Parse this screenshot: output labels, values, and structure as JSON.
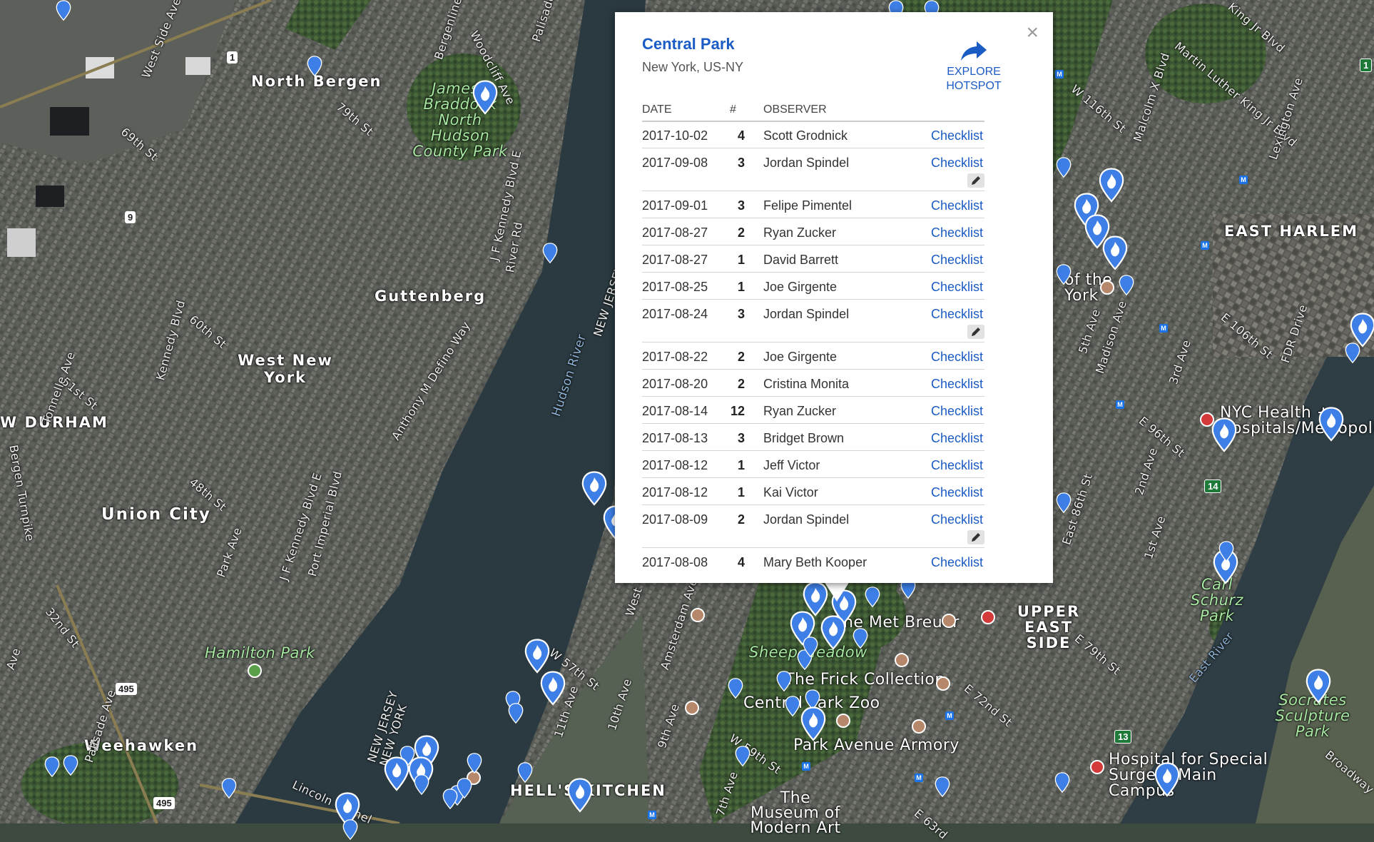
{
  "map": {
    "labels": {
      "north_bergen": "North Bergen",
      "guttenberg": "Guttenberg",
      "west_new_york": "West New York",
      "union_city": "Union City",
      "weehawken": "Weehawken",
      "hells_kitchen": "HELL'S KITCHEN",
      "upper_east_side": "UPPER EAST SIDE",
      "east_harlem": "EAST HARLEM",
      "w_durham": "W DURHAM",
      "james_braddock": "James J Braddock North Hudson County Park",
      "hamilton_park": "Hamilton Park",
      "carl_schurz": "Carl Schurz Park",
      "socrates": "Socrates Sculpture Park",
      "sheep_meadow": "Sheep Meadow",
      "met_breuer": "The Met Breuer",
      "frick": "The Frick Collection",
      "central_park_zoo": "Central Park Zoo",
      "park_ave_armory": "Park Avenue Armory",
      "moma": "The Museum of Modern Art",
      "nyc_health": "NYC Health + Hospitals/Metropolitan",
      "hss": "Hospital for Special Surgery Main Campus",
      "museum_city_ny": "of the York",
      "hudson_river": "Hudson River",
      "nj_ny_1": "NEW JERSEY NEW YORK",
      "nj_ny_2": "NEW JERSEY",
      "st_west_side_ave": "West Side Ave",
      "st_bergenline": "Bergenline Ave",
      "st_woodcliff": "Woodcliff Ave",
      "st_palisade": "Palisade Ave",
      "st_69th": "69th St",
      "st_79th": "79th St",
      "st_60th": "60th St",
      "st_51st": "51st St",
      "st_48th": "48th St",
      "st_32nd": "32nd St",
      "st_kennedy": "Kennedy Blvd",
      "st_jfk": "J F Kennedy Blvd E",
      "st_anthony": "Anthony M Defino Way",
      "st_river": "River Rd",
      "st_tonnelle": "Tonnelle Ave",
      "st_bergen_tpk": "Bergen Turnpike",
      "st_park_ave": "Park Ave",
      "st_port_imperial": "Port Imperial Blvd",
      "st_jfk_2": "J F Kennedy Blvd E",
      "st_lincoln": "Lincoln Tunnel",
      "st_w57": "W 57th St",
      "st_11th": "11th Ave",
      "st_10th": "10th Ave",
      "st_9th": "9th Ave",
      "st_7th": "7th Ave",
      "st_amsterdam": "Amsterdam Ave",
      "st_w59": "W 59th St",
      "st_e72": "E 72nd St",
      "st_e79": "E 79th St",
      "st_e86": "East 86th St",
      "st_e96": "E 96th St",
      "st_e106": "E 106th St",
      "st_w116": "W 116th St",
      "st_mlk": "Martin Luther King Jr Blvd",
      "st_malcolm": "Malcolm X Blvd",
      "st_5th": "5th Ave",
      "st_madison": "Madison Ave",
      "st_3rd": "3rd Ave",
      "st_2nd": "2nd Ave",
      "st_1st": "1st Ave",
      "st_lexington": "Lexington Ave",
      "st_fdr": "FDR Drive",
      "st_east_river": "East River",
      "st_broadway": "Broadway",
      "st_west": "West",
      "st_palisade2": "Palisade Ave",
      "st_ave": "Ave",
      "st_king": "King Jr Blvd",
      "st_e63": "E 63rd"
    },
    "shields": {
      "us1": "1",
      "us9": "9",
      "i495a": "495",
      "i495b": "495",
      "r14": "14",
      "r13": "13",
      "r1": "1"
    },
    "colors": {
      "pin": "#3d7fe6",
      "land": "#4f5a4c",
      "water": "#2d3c43",
      "park": "#3f5d36"
    }
  },
  "popup": {
    "title": "Central Park",
    "subtitle": "New York, US-NY",
    "close_label": "×",
    "explore_line1": "EXPLORE",
    "explore_line2": "HOTSPOT",
    "headers": {
      "date": "DATE",
      "num": "#",
      "observer": "OBSERVER"
    },
    "rows": [
      {
        "date": "2017-10-02",
        "num": "4",
        "observer": "Scott Grodnick",
        "link": "Checklist",
        "edit": false
      },
      {
        "date": "2017-09-08",
        "num": "3",
        "observer": "Jordan Spindel",
        "link": "Checklist",
        "edit": true
      },
      {
        "date": "2017-09-01",
        "num": "3",
        "observer": "Felipe Pimentel",
        "link": "Checklist",
        "edit": false
      },
      {
        "date": "2017-08-27",
        "num": "2",
        "observer": "Ryan Zucker",
        "link": "Checklist",
        "edit": false
      },
      {
        "date": "2017-08-27",
        "num": "1",
        "observer": "David Barrett",
        "link": "Checklist",
        "edit": false
      },
      {
        "date": "2017-08-25",
        "num": "1",
        "observer": "Joe Girgente",
        "link": "Checklist",
        "edit": false
      },
      {
        "date": "2017-08-24",
        "num": "3",
        "observer": "Jordan Spindel",
        "link": "Checklist",
        "edit": true
      },
      {
        "date": "2017-08-22",
        "num": "2",
        "observer": "Joe Girgente",
        "link": "Checklist",
        "edit": false
      },
      {
        "date": "2017-08-20",
        "num": "2",
        "observer": "Cristina Monita",
        "link": "Checklist",
        "edit": false
      },
      {
        "date": "2017-08-14",
        "num": "12",
        "observer": "Ryan Zucker",
        "link": "Checklist",
        "edit": false
      },
      {
        "date": "2017-08-13",
        "num": "3",
        "observer": "Bridget Brown",
        "link": "Checklist",
        "edit": false
      },
      {
        "date": "2017-08-12",
        "num": "1",
        "observer": "Jeff Victor",
        "link": "Checklist",
        "edit": false
      },
      {
        "date": "2017-08-12",
        "num": "1",
        "observer": "Kai Victor",
        "link": "Checklist",
        "edit": false
      },
      {
        "date": "2017-08-09",
        "num": "2",
        "observer": "Jordan Spindel",
        "link": "Checklist",
        "edit": true
      },
      {
        "date": "2017-08-08",
        "num": "4",
        "observer": "Mary Beth Kooper",
        "link": "Checklist",
        "edit": true
      }
    ]
  }
}
